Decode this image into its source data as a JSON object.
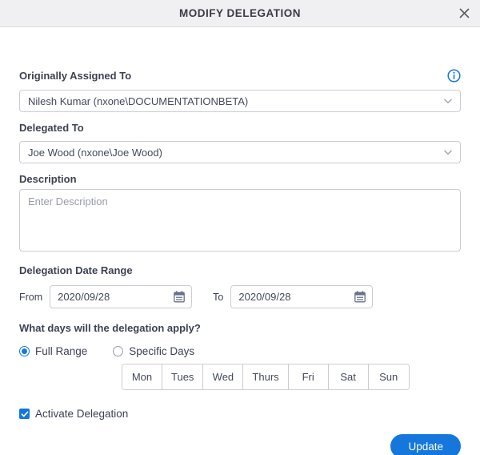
{
  "header": {
    "title": "MODIFY DELEGATION",
    "close_icon": "close-icon"
  },
  "form": {
    "originally_assigned": {
      "label": "Originally Assigned To",
      "value": "Nilesh Kumar (nxone\\DOCUMENTATIONBETA)",
      "info_icon": "info-icon",
      "chevron_icon": "chevron-down-icon"
    },
    "delegated_to": {
      "label": "Delegated To",
      "value": "Joe Wood (nxone\\Joe Wood)",
      "chevron_icon": "chevron-down-icon"
    },
    "description": {
      "label": "Description",
      "value": "",
      "placeholder": "Enter Description"
    },
    "date_range": {
      "label": "Delegation Date Range",
      "from_label": "From",
      "from_value": "2020/09/28",
      "to_label": "To",
      "to_value": "2020/09/28",
      "calendar_icon": "calendar-icon"
    },
    "days_question": "What days will the delegation apply?",
    "range_mode": {
      "options": [
        {
          "label": "Full Range",
          "selected": true
        },
        {
          "label": "Specific Days",
          "selected": false
        }
      ]
    },
    "day_buttons": [
      "Mon",
      "Tues",
      "Wed",
      "Thurs",
      "Fri",
      "Sat",
      "Sun"
    ],
    "activate": {
      "label": "Activate Delegation",
      "checked": true
    }
  },
  "footer": {
    "update_label": "Update"
  },
  "colors": {
    "accent": "#1577dc",
    "header_bg": "#f0f0f2",
    "text": "#3d4253",
    "border": "#ccccd6",
    "placeholder": "#9a9cac"
  }
}
